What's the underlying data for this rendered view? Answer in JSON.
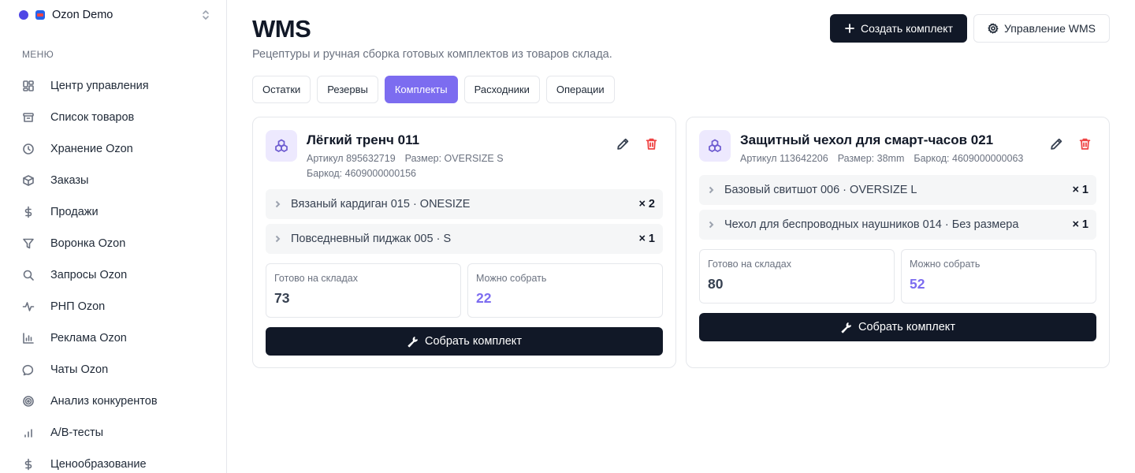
{
  "org": {
    "name": "Ozon Demo"
  },
  "sidebar": {
    "section_label": "МЕНЮ",
    "items": [
      {
        "label": "Центр управления",
        "icon": "dashboard-icon"
      },
      {
        "label": "Список товаров",
        "icon": "archive-icon"
      },
      {
        "label": "Хранение Ozon",
        "icon": "clock-icon"
      },
      {
        "label": "Заказы",
        "icon": "package-icon"
      },
      {
        "label": "Продажи",
        "icon": "dollar-icon"
      },
      {
        "label": "Воронка Ozon",
        "icon": "filter-icon"
      },
      {
        "label": "Запросы Ozon",
        "icon": "search-icon"
      },
      {
        "label": "РНП Ozon",
        "icon": "activity-icon"
      },
      {
        "label": "Реклама Ozon",
        "icon": "bar-chart-icon"
      },
      {
        "label": "Чаты Ozon",
        "icon": "message-icon"
      },
      {
        "label": "Анализ конкурентов",
        "icon": "target-icon"
      },
      {
        "label": "A/B-тесты",
        "icon": "signal-bars-icon"
      },
      {
        "label": "Ценообразование",
        "icon": "dollar-icon"
      }
    ]
  },
  "header": {
    "title": "WMS",
    "subtitle": "Рецептуры и ручная сборка готовых комплектов из товаров склада.",
    "create_label": "Создать комплект",
    "manage_label": "Управление WMS"
  },
  "tabs": [
    {
      "label": "Остатки",
      "active": false
    },
    {
      "label": "Резервы",
      "active": false
    },
    {
      "label": "Комплекты",
      "active": true
    },
    {
      "label": "Расходники",
      "active": false
    },
    {
      "label": "Операции",
      "active": false
    }
  ],
  "kits": [
    {
      "title": "Лёгкий тренч 011",
      "article": "Артикул 895632719",
      "size": "Размер: OVERSIZE S",
      "barcode": "Баркод: 4609000000156",
      "components": [
        {
          "name": "Вязаный кардиган 015 · ONESIZE",
          "qty": "× 2"
        },
        {
          "name": "Повседневный пиджак 005 · S",
          "qty": "× 1"
        }
      ],
      "ready_label": "Готово на складах",
      "ready_value": "73",
      "buildable_label": "Можно собрать",
      "buildable_value": "22",
      "build_label": "Собрать комплект"
    },
    {
      "title": "Защитный чехол для смарт-часов 021",
      "article": "Артикул 113642206",
      "size": "Размер: 38mm",
      "barcode": "Баркод: 4609000000063",
      "components": [
        {
          "name": "Базовый свитшот 006 · OVERSIZE L",
          "qty": "× 1"
        },
        {
          "name": "Чехол для беспроводных наушников 014 · Без размера",
          "qty": "× 1"
        }
      ],
      "ready_label": "Готово на складах",
      "ready_value": "80",
      "buildable_label": "Можно собрать",
      "buildable_value": "52",
      "build_label": "Собрать комплект"
    }
  ],
  "colors": {
    "accent": "#7c6cf0",
    "primary_button": "#111827",
    "danger": "#ef4444"
  }
}
